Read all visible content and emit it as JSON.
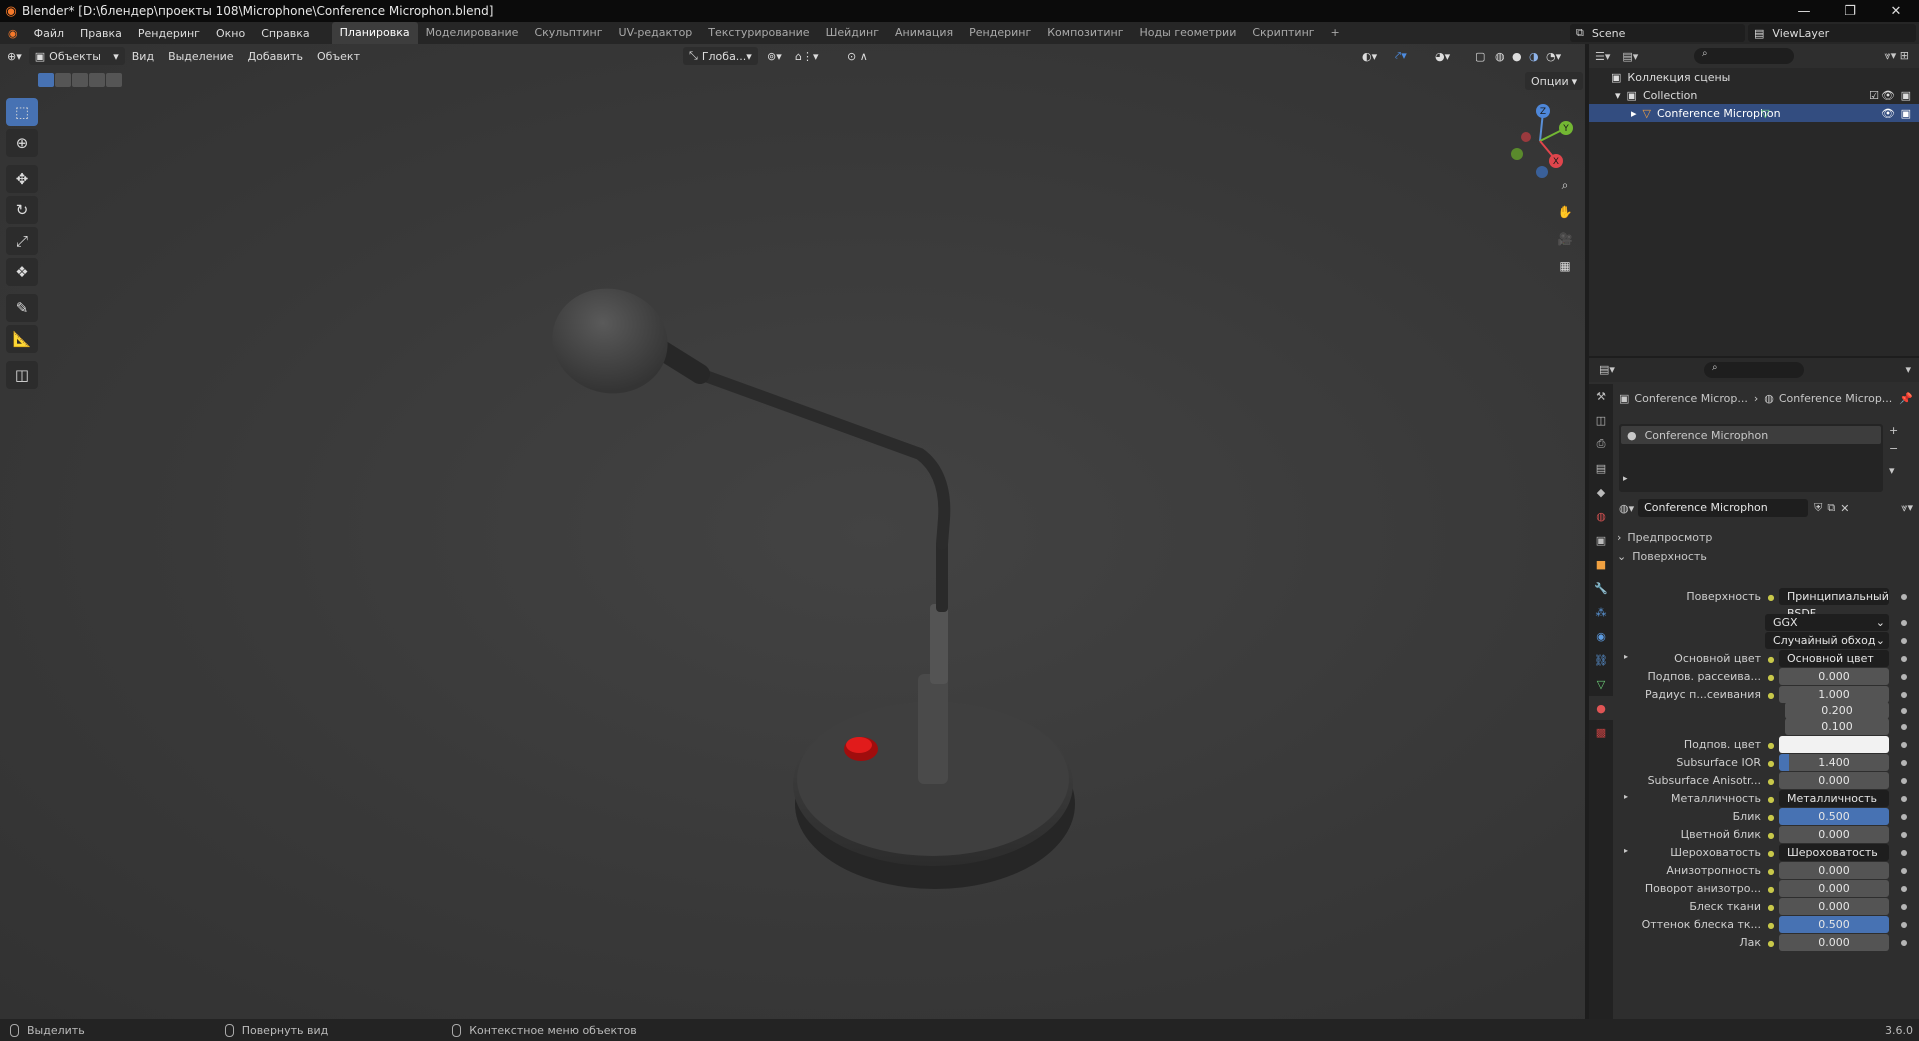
{
  "window": {
    "title": "Blender* [D:\\блендер\\проекты 108\\Microphone\\Conference Microphon.blend]",
    "min": "—",
    "max": "❐",
    "close": "✕"
  },
  "menu": [
    "Файл",
    "Правка",
    "Рендеринг",
    "Окно",
    "Справка"
  ],
  "workspaces": [
    "Планировка",
    "Моделирование",
    "Скульптинг",
    "UV-редактор",
    "Текстурирование",
    "Шейдинг",
    "Анимация",
    "Рендеринг",
    "Композитинг",
    "Ноды геометрии",
    "Скриптинг"
  ],
  "add_workspace": "+",
  "scene": {
    "name": "Scene",
    "view_layer": "ViewLayer"
  },
  "viewport": {
    "mode": "Объекты",
    "menus": [
      "Вид",
      "Выделение",
      "Добавить",
      "Объект"
    ],
    "transform_orientation": "Глоба...",
    "options": "Опции",
    "gizmo": {
      "z": "Z",
      "y": "Y",
      "x": "X"
    }
  },
  "outliner": {
    "rows": [
      "Коллекция сцены",
      "Collection",
      "Conference Microphon"
    ]
  },
  "properties": {
    "breadcrumb": [
      "Conference Microp...",
      "Conference Microp..."
    ],
    "slot": "Conference Microphon",
    "material": "Conference Microphon",
    "panels": {
      "preview": "Предпросмотр",
      "surface": "Поверхность"
    },
    "rows": [
      {
        "label": "Поверхность",
        "value": "Принципиальный BSDF"
      },
      {
        "label": "",
        "value": "GGX"
      },
      {
        "label": "",
        "value": "Случайный обход"
      },
      {
        "label": "Основной цвет",
        "value": "Основной цвет"
      },
      {
        "label": "Подпов. рассеива...",
        "value": "0.000"
      },
      {
        "label": "Радиус п...сеивания",
        "value": "1.000"
      },
      {
        "label": "",
        "value": "0.200"
      },
      {
        "label": "",
        "value": "0.100"
      },
      {
        "label": "Подпов. цвет",
        "value": ""
      },
      {
        "label": "Subsurface IOR",
        "value": "1.400"
      },
      {
        "label": "Subsurface Anisotr...",
        "value": "0.000"
      },
      {
        "label": "Металличность",
        "value": "Металличность"
      },
      {
        "label": "Блик",
        "value": "0.500"
      },
      {
        "label": "Цветной блик",
        "value": "0.000"
      },
      {
        "label": "Шероховатость",
        "value": "Шероховатость"
      },
      {
        "label": "Анизотропность",
        "value": "0.000"
      },
      {
        "label": "Поворот анизотро...",
        "value": "0.000"
      },
      {
        "label": "Блеск ткани",
        "value": "0.000"
      },
      {
        "label": "Оттенок блеска тк...",
        "value": "0.500"
      },
      {
        "label": "Лак",
        "value": "0.000"
      }
    ]
  },
  "status": {
    "select": "Выделить",
    "rotate": "Повернуть вид",
    "context": "Контекстное меню объектов",
    "version": "3.6.0"
  },
  "colors": {
    "accent": "#4772b3",
    "viewport_bg": "#3b3b3b",
    "selected_row": "#334d80"
  }
}
